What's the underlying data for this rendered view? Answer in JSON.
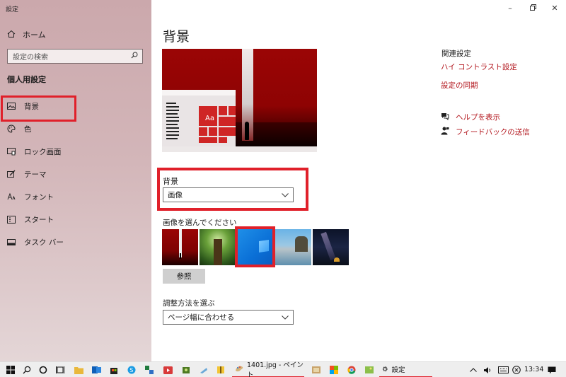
{
  "window": {
    "title": "設定"
  },
  "sidebar": {
    "home_label": "ホーム",
    "search_placeholder": "設定の検索",
    "section_title": "個人用設定",
    "items": [
      {
        "label": "背景",
        "icon": "picture-icon",
        "selected": true
      },
      {
        "label": "色",
        "icon": "palette-icon",
        "selected": false
      },
      {
        "label": "ロック画面",
        "icon": "lock-screen-icon",
        "selected": false
      },
      {
        "label": "テーマ",
        "icon": "theme-brush-icon",
        "selected": false
      },
      {
        "label": "フォント",
        "icon": "font-icon",
        "selected": false
      },
      {
        "label": "スタート",
        "icon": "start-grid-icon",
        "selected": false
      },
      {
        "label": "タスク バー",
        "icon": "taskbar-icon",
        "selected": false
      }
    ]
  },
  "main": {
    "title": "背景",
    "preview_tile_text": "Aa",
    "background_label": "背景",
    "background_value": "画像",
    "choose_label": "画像を選んでください",
    "browse_label": "参照",
    "fit_label": "調整方法を選ぶ",
    "fit_value": "ページ幅に合わせる"
  },
  "related": {
    "title": "関連設定",
    "links": [
      "ハイ コントラスト設定",
      "設定の同期"
    ],
    "help_label": "ヘルプを表示",
    "feedback_label": "フィードバックの送信"
  },
  "taskbar": {
    "paint_app_label": "1401.jpg - ペイント",
    "settings_app_label": "設定",
    "clock": "13:34"
  },
  "colors": {
    "accent": "#b2151c",
    "highlight_box": "#e0202a",
    "sidebar_bg": "#cba8ac"
  }
}
